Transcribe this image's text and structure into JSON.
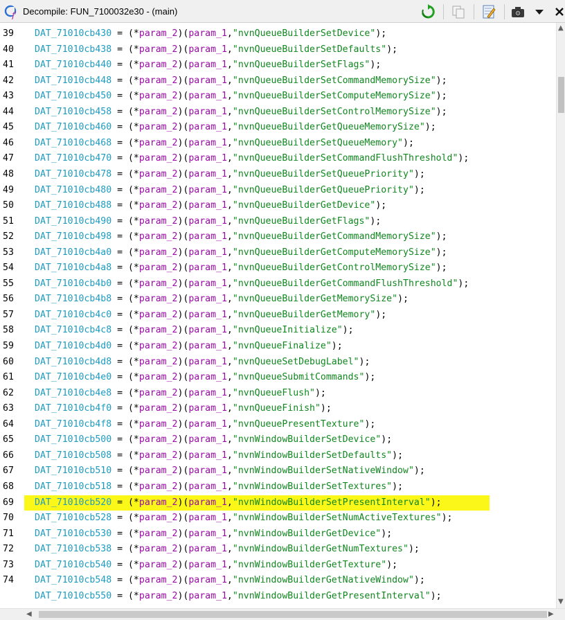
{
  "window": {
    "title": "Decompile: FUN_7100032e30 -  (main)",
    "icons": [
      "refresh-icon",
      "copy-icon",
      "edit-icon",
      "snapshot-icon",
      "dropdown-icon",
      "close-icon"
    ]
  },
  "colors": {
    "variable": "#1e9bbf",
    "param": "#9a0aa6",
    "string": "#10871f",
    "highlight": "#fbf719"
  },
  "highlighted_line": "69",
  "lines": [
    {
      "num": "39",
      "var": "DAT_71010cb430",
      "str": "\"nvnQueueBuilderSetDevice\""
    },
    {
      "num": "40",
      "var": "DAT_71010cb438",
      "str": "\"nvnQueueBuilderSetDefaults\""
    },
    {
      "num": "41",
      "var": "DAT_71010cb440",
      "str": "\"nvnQueueBuilderSetFlags\""
    },
    {
      "num": "42",
      "var": "DAT_71010cb448",
      "str": "\"nvnQueueBuilderSetCommandMemorySize\""
    },
    {
      "num": "43",
      "var": "DAT_71010cb450",
      "str": "\"nvnQueueBuilderSetComputeMemorySize\""
    },
    {
      "num": "44",
      "var": "DAT_71010cb458",
      "str": "\"nvnQueueBuilderSetControlMemorySize\""
    },
    {
      "num": "45",
      "var": "DAT_71010cb460",
      "str": "\"nvnQueueBuilderGetQueueMemorySize\""
    },
    {
      "num": "46",
      "var": "DAT_71010cb468",
      "str": "\"nvnQueueBuilderSetQueueMemory\""
    },
    {
      "num": "47",
      "var": "DAT_71010cb470",
      "str": "\"nvnQueueBuilderSetCommandFlushThreshold\""
    },
    {
      "num": "48",
      "var": "DAT_71010cb478",
      "str": "\"nvnQueueBuilderSetQueuePriority\""
    },
    {
      "num": "49",
      "var": "DAT_71010cb480",
      "str": "\"nvnQueueBuilderGetQueuePriority\""
    },
    {
      "num": "50",
      "var": "DAT_71010cb488",
      "str": "\"nvnQueueBuilderGetDevice\""
    },
    {
      "num": "51",
      "var": "DAT_71010cb490",
      "str": "\"nvnQueueBuilderGetFlags\""
    },
    {
      "num": "52",
      "var": "DAT_71010cb498",
      "str": "\"nvnQueueBuilderGetCommandMemorySize\""
    },
    {
      "num": "53",
      "var": "DAT_71010cb4a0",
      "str": "\"nvnQueueBuilderGetComputeMemorySize\""
    },
    {
      "num": "54",
      "var": "DAT_71010cb4a8",
      "str": "\"nvnQueueBuilderGetControlMemorySize\""
    },
    {
      "num": "55",
      "var": "DAT_71010cb4b0",
      "str": "\"nvnQueueBuilderGetCommandFlushThreshold\""
    },
    {
      "num": "56",
      "var": "DAT_71010cb4b8",
      "str": "\"nvnQueueBuilderGetMemorySize\""
    },
    {
      "num": "57",
      "var": "DAT_71010cb4c0",
      "str": "\"nvnQueueBuilderGetMemory\""
    },
    {
      "num": "58",
      "var": "DAT_71010cb4c8",
      "str": "\"nvnQueueInitialize\""
    },
    {
      "num": "59",
      "var": "DAT_71010cb4d0",
      "str": "\"nvnQueueFinalize\""
    },
    {
      "num": "60",
      "var": "DAT_71010cb4d8",
      "str": "\"nvnQueueSetDebugLabel\""
    },
    {
      "num": "61",
      "var": "DAT_71010cb4e0",
      "str": "\"nvnQueueSubmitCommands\""
    },
    {
      "num": "62",
      "var": "DAT_71010cb4e8",
      "str": "\"nvnQueueFlush\""
    },
    {
      "num": "63",
      "var": "DAT_71010cb4f0",
      "str": "\"nvnQueueFinish\""
    },
    {
      "num": "64",
      "var": "DAT_71010cb4f8",
      "str": "\"nvnQueuePresentTexture\""
    },
    {
      "num": "65",
      "var": "DAT_71010cb500",
      "str": "\"nvnWindowBuilderSetDevice\""
    },
    {
      "num": "66",
      "var": "DAT_71010cb508",
      "str": "\"nvnWindowBuilderSetDefaults\""
    },
    {
      "num": "67",
      "var": "DAT_71010cb510",
      "str": "\"nvnWindowBuilderSetNativeWindow\""
    },
    {
      "num": "68",
      "var": "DAT_71010cb518",
      "str": "\"nvnWindowBuilderSetTextures\""
    },
    {
      "num": "69",
      "var": "DAT_71010cb520",
      "str": "\"nvnWindowBuilderSetPresentInterval\""
    },
    {
      "num": "70",
      "var": "DAT_71010cb528",
      "str": "\"nvnWindowBuilderSetNumActiveTextures\""
    },
    {
      "num": "71",
      "var": "DAT_71010cb530",
      "str": "\"nvnWindowBuilderGetDevice\""
    },
    {
      "num": "72",
      "var": "DAT_71010cb538",
      "str": "\"nvnWindowBuilderGetNumTextures\""
    },
    {
      "num": "73",
      "var": "DAT_71010cb540",
      "str": "\"nvnWindowBuilderGetTexture\""
    },
    {
      "num": "74",
      "var": "DAT_71010cb548",
      "str": "\"nvnWindowBuilderGetNativeWindow\""
    },
    {
      "num": "",
      "var": "DAT_71010cb550",
      "str": "\"nvnWindowBuilderGetPresentInterval\""
    }
  ],
  "code_parts": {
    "assign": " = (",
    "star": "*",
    "param2": "param_2",
    "close_open": ")(",
    "param1": "param_1",
    "comma": ",",
    "end": ");"
  }
}
